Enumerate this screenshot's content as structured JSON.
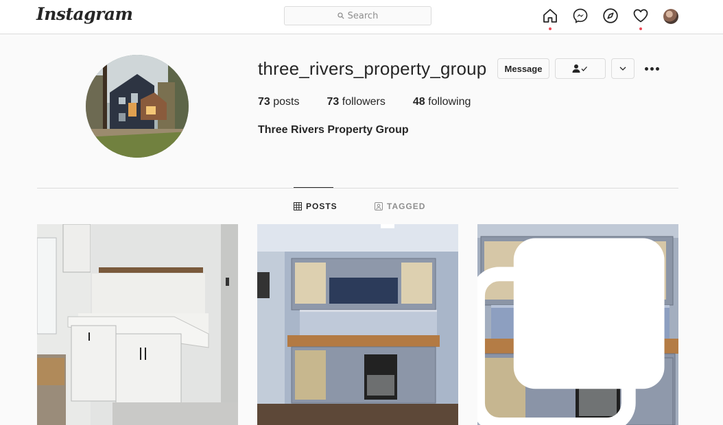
{
  "nav": {
    "logo": "Instagram",
    "search_placeholder": "Search",
    "icons": [
      "home-icon",
      "messenger-icon",
      "explore-icon",
      "activity-icon",
      "profile-avatar"
    ],
    "notification_color": "#ed4956"
  },
  "profile": {
    "username": "three_rivers_property_group",
    "message_label": "Message",
    "stats": {
      "posts_count": "73",
      "posts_label": "posts",
      "followers_count": "73",
      "followers_label": "followers",
      "following_count": "48",
      "following_label": "following"
    },
    "full_name": "Three Rivers Property Group"
  },
  "tabs": {
    "posts": "POSTS",
    "tagged": "TAGGED"
  },
  "posts": [
    {
      "subject": "white kitchen cabinets with wood shelf"
    },
    {
      "subject": "grey bar cabinets with butcher block counter"
    },
    {
      "subject": "grey bar cabinets with wine rack",
      "multi": true
    }
  ]
}
